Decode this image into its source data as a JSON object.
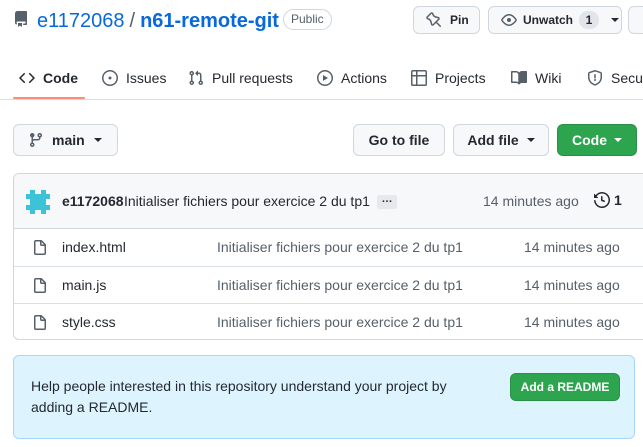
{
  "repo": {
    "owner": "e1172068",
    "separator": "/",
    "name": "n61-remote-git",
    "visibility": "Public"
  },
  "header_actions": {
    "pin_label": "Pin",
    "watch_label": "Unwatch",
    "watch_count": "1"
  },
  "tabs": [
    {
      "label": "Code",
      "icon": "code-icon",
      "active": true
    },
    {
      "label": "Issues",
      "icon": "issue-opened-icon"
    },
    {
      "label": "Pull requests",
      "icon": "git-pull-request-icon"
    },
    {
      "label": "Actions",
      "icon": "play-icon"
    },
    {
      "label": "Projects",
      "icon": "table-icon"
    },
    {
      "label": "Wiki",
      "icon": "book-icon"
    },
    {
      "label": "Secu",
      "icon": "shield-icon"
    }
  ],
  "toolbar": {
    "branch": "main",
    "go_to_file": "Go to file",
    "add_file": "Add file",
    "code": "Code"
  },
  "latest_commit": {
    "author": "e1172068",
    "message": "Initialiser fichiers pour exercice 2 du tp1",
    "ellipsis": "…",
    "time": "14 minutes ago",
    "commit_count": "1"
  },
  "files": [
    {
      "name": "index.html",
      "message": "Initialiser fichiers pour exercice 2 du tp1",
      "time": "14 minutes ago"
    },
    {
      "name": "main.js",
      "message": "Initialiser fichiers pour exercice 2 du tp1",
      "time": "14 minutes ago"
    },
    {
      "name": "style.css",
      "message": "Initialiser fichiers pour exercice 2 du tp1",
      "time": "14 minutes ago"
    }
  ],
  "readme_prompt": {
    "text": "Help people interested in this repository understand your project by adding a README.",
    "button": "Add a README"
  },
  "colors": {
    "link": "#0969da",
    "primary_button": "#2da44e",
    "tab_underline": "#fd8c73",
    "banner_bg": "#ddf4ff",
    "avatar": "#3dc3d8"
  }
}
